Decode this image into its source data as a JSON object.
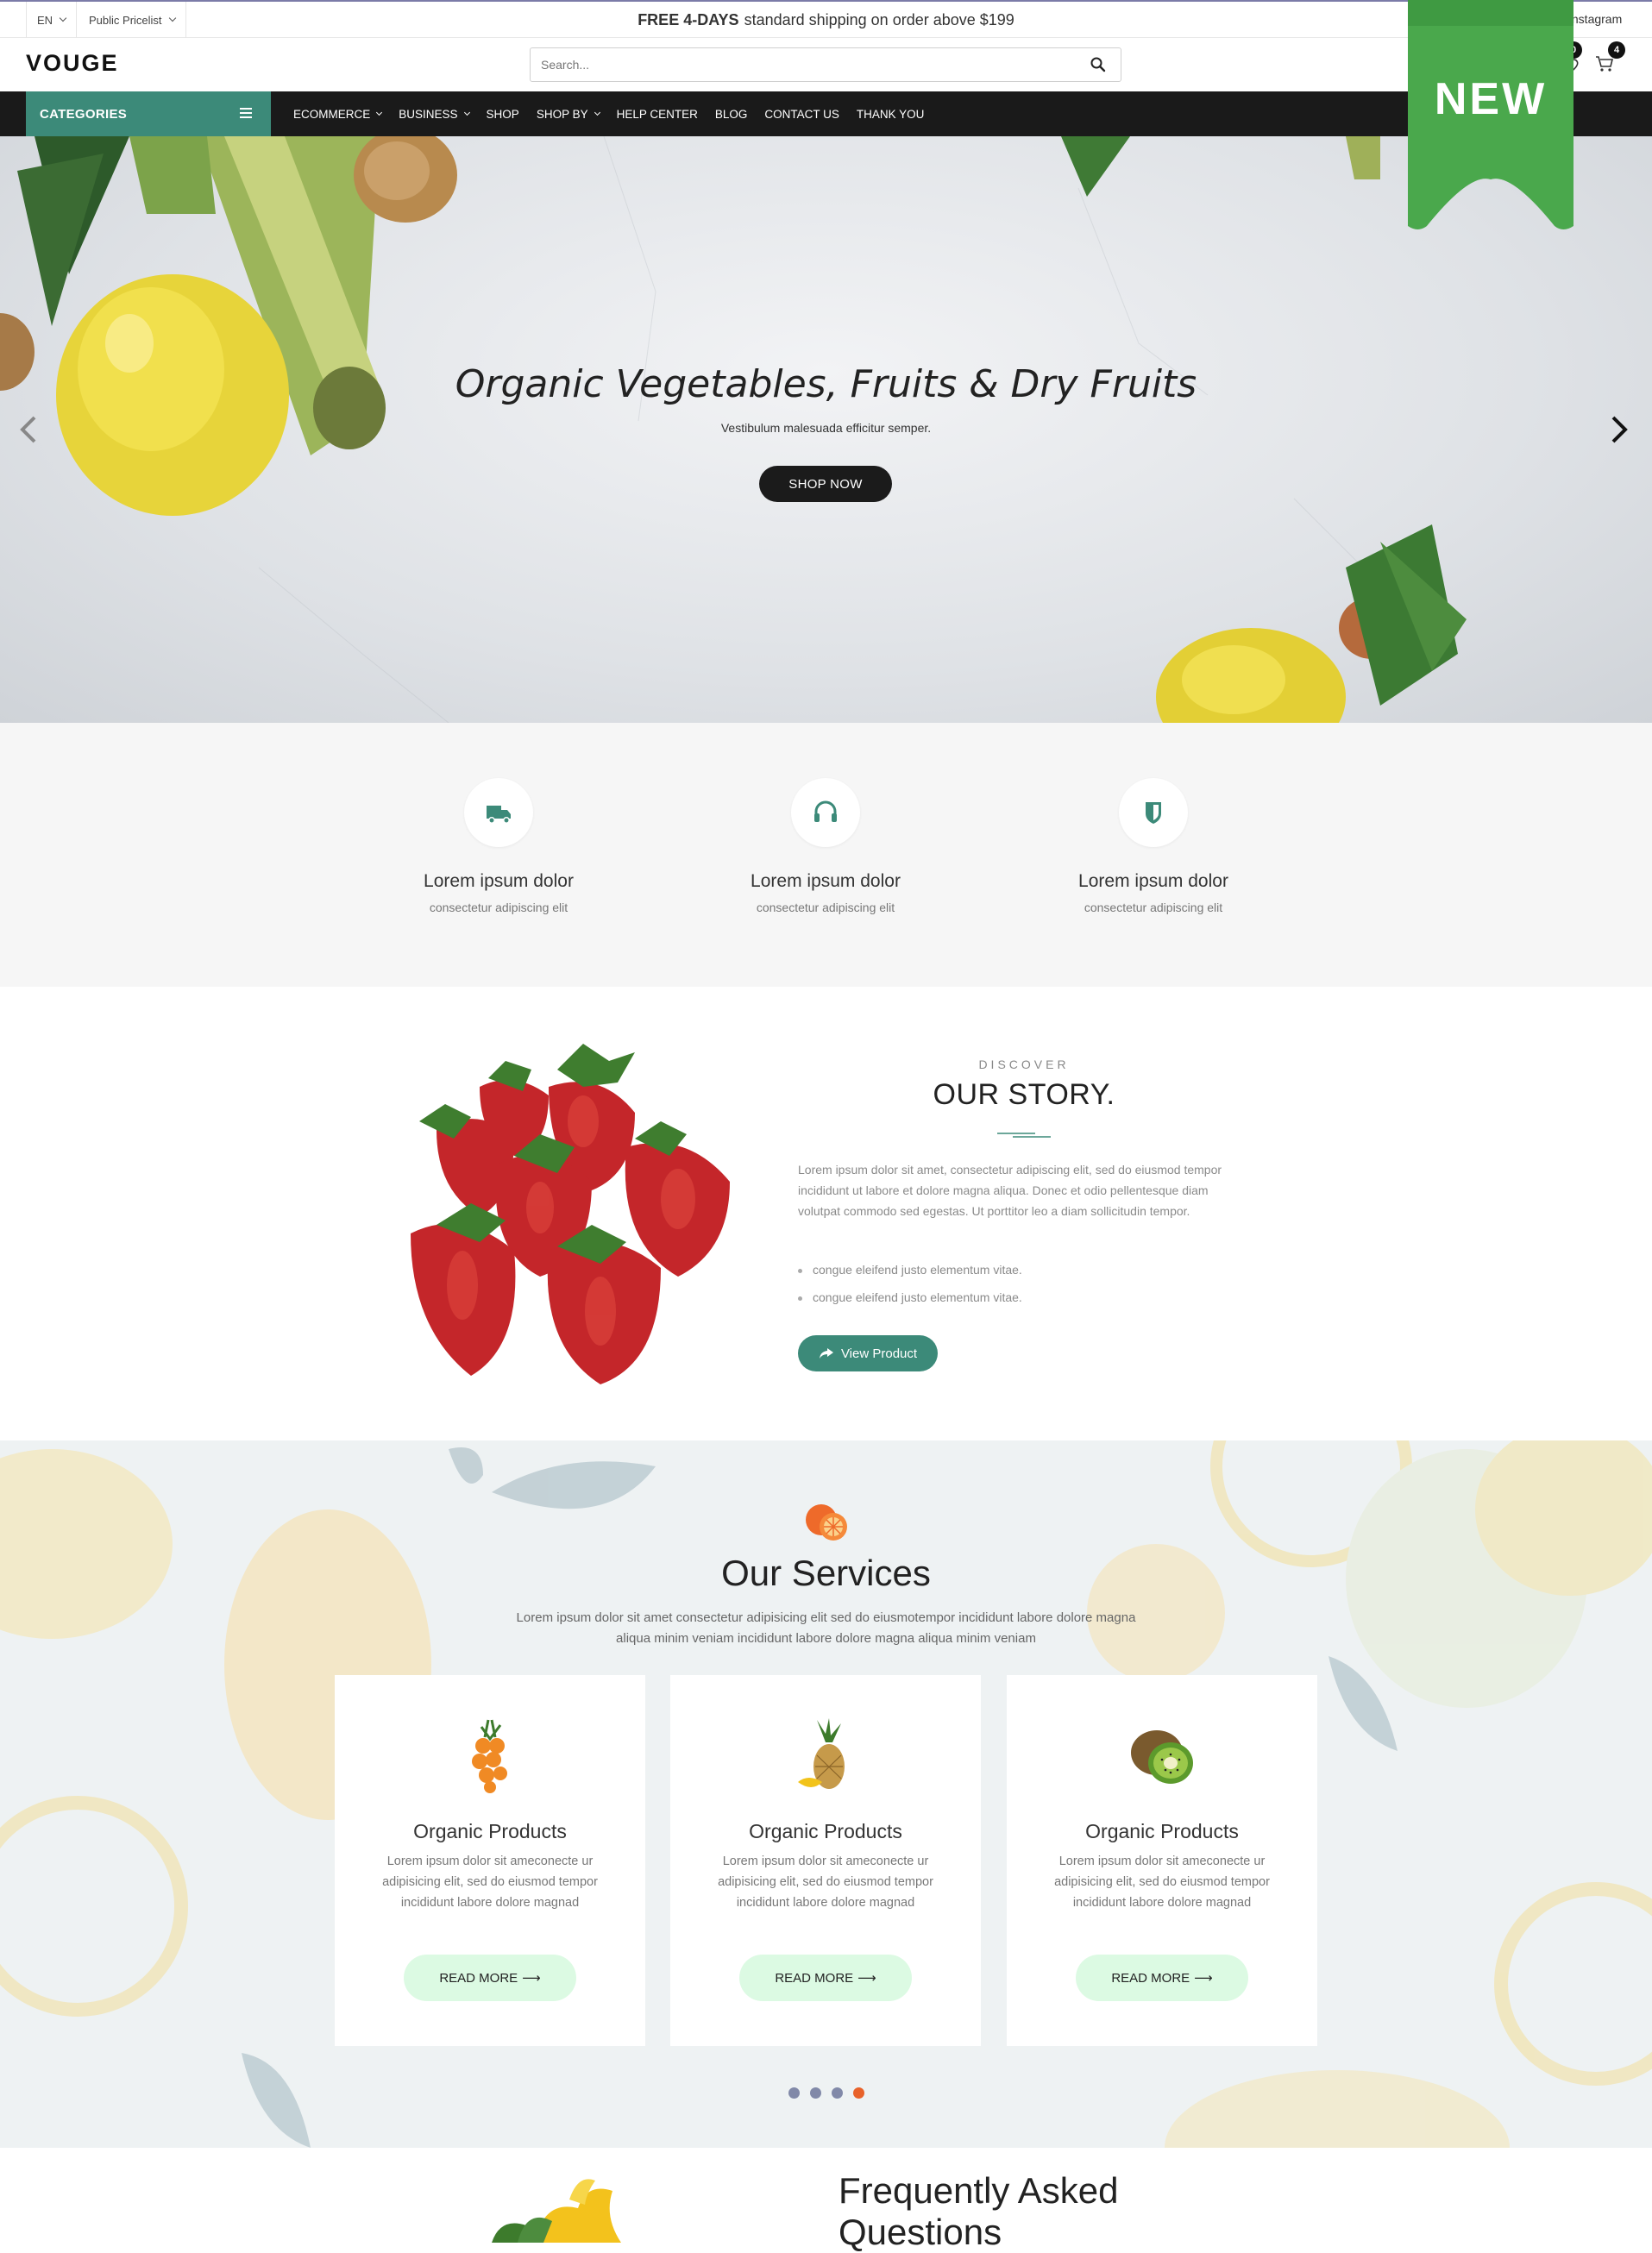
{
  "topbar": {
    "language": "EN",
    "pricelist": "Public Pricelist",
    "shipping_bold": "FREE 4-DAYS",
    "shipping_rest": "standard shipping on order above $199",
    "social": "Instagram"
  },
  "header": {
    "logo": "VOUGE",
    "search_placeholder": "Search...",
    "wishlist_count": "0",
    "cart_count": "4"
  },
  "ribbon": {
    "label": "NEW",
    "color": "#4aa84c"
  },
  "nav": {
    "categories_label": "CATEGORIES",
    "items": [
      {
        "label": "ECOMMERCE"
      },
      {
        "label": "BUSINESS"
      },
      {
        "label": "SHOP"
      },
      {
        "label": "SHOP BY"
      },
      {
        "label": "HELP CENTER"
      },
      {
        "label": "BLOG"
      },
      {
        "label": "CONTACT US"
      },
      {
        "label": "THANK YOU"
      }
    ]
  },
  "hero": {
    "title": "Organic Vegetables, Fruits & Dry Fruits",
    "subtitle": "Vestibulum malesuada efficitur semper.",
    "button": "SHOP NOW"
  },
  "features": [
    {
      "icon": "truck-icon",
      "title": "Lorem ipsum dolor",
      "text": "consectetur adipiscing elit"
    },
    {
      "icon": "headphones-icon",
      "title": "Lorem ipsum dolor",
      "text": "consectetur adipiscing elit"
    },
    {
      "icon": "shield-icon",
      "title": "Lorem ipsum dolor",
      "text": "consectetur adipiscing elit"
    }
  ],
  "story": {
    "eyebrow": "DISCOVER",
    "title": "OUR STORY.",
    "paragraph": "Lorem ipsum dolor sit amet, consectetur adipiscing elit, sed do eiusmod tempor incididunt ut labore et dolore magna aliqua. Donec et odio pellentesque diam volutpat commodo sed egestas. Ut porttitor leo a diam sollicitudin tempor.",
    "bullets": [
      "congue eleifend justo elementum vitae.",
      "congue eleifend justo elementum vitae."
    ],
    "button": "View Product"
  },
  "services": {
    "title": "Our Services",
    "subtitle": "Lorem ipsum dolor sit amet consectetur adipisicing elit sed do eiusmotempor incididunt labore dolore magna aliqua minim veniam incididunt labore dolore magna aliqua minim veniam",
    "cards": [
      {
        "icon": "sea-buckthorn-icon",
        "title": "Organic Products",
        "text": "Lorem ipsum dolor sit ameconecte ur adipisicing elit, sed do eiusmod tempor incididunt labore dolore magnad",
        "button": "READ MORE"
      },
      {
        "icon": "pineapple-icon",
        "title": "Organic Products",
        "text": "Lorem ipsum dolor sit ameconecte ur adipisicing elit, sed do eiusmod tempor incididunt labore dolore magnad",
        "button": "READ MORE"
      },
      {
        "icon": "kiwi-icon",
        "title": "Organic Products",
        "text": "Lorem ipsum dolor sit ameconecte ur adipisicing elit, sed do eiusmod tempor incididunt labore dolore magnad",
        "button": "READ MORE"
      }
    ],
    "active_dot": 4,
    "dot_count": 4
  },
  "faq": {
    "title_line1": "Frequently Asked",
    "title_line2": "Questions"
  },
  "colors": {
    "accent": "#3c8a79",
    "nav_bg": "#1a1a1a",
    "mint": "#dcfae3",
    "active_dot": "#e8622a"
  }
}
